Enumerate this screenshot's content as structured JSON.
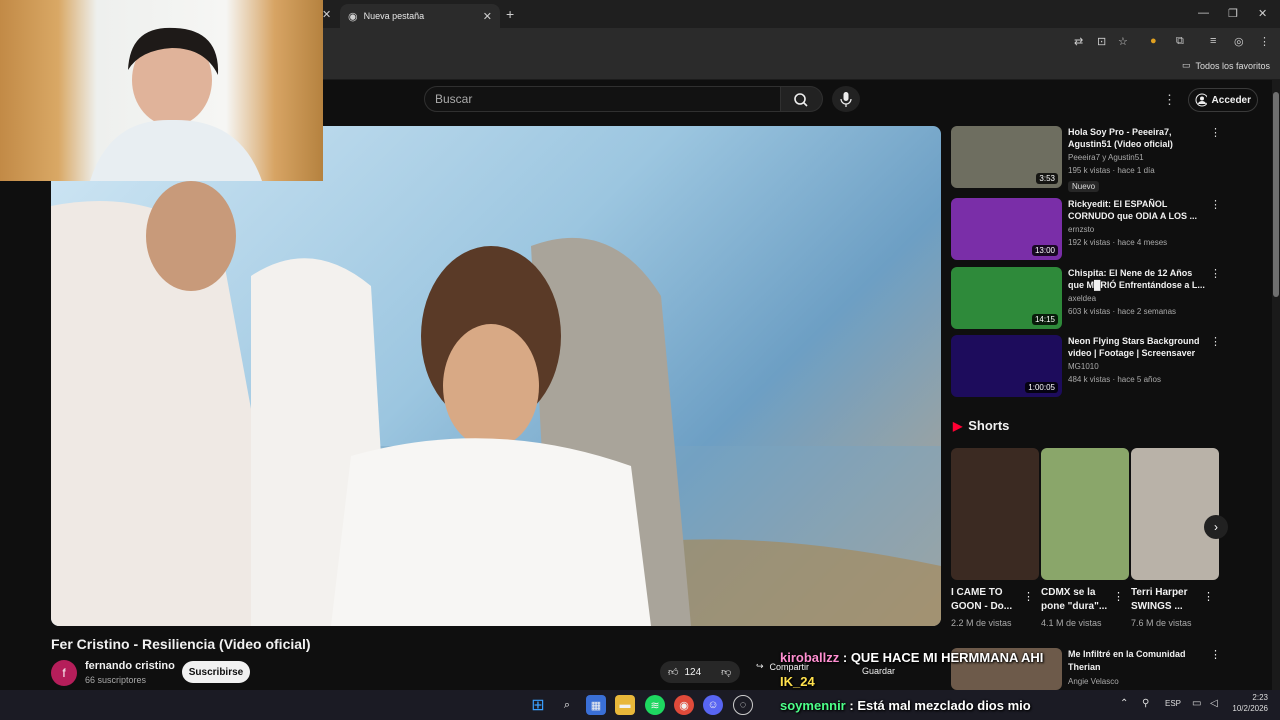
{
  "browser": {
    "tab_title": "Nueva pestaña",
    "bookmarks_label": "Todos los favoritos"
  },
  "search": {
    "placeholder": "Buscar"
  },
  "header": {
    "signin": "Acceder"
  },
  "video": {
    "title": "Fer Cristino - Resiliencia (Video oficial)",
    "channel": "fernando cristino",
    "channel_initial": "f",
    "subscribers": "66 suscriptores",
    "subscribe_label": "Suscribirse",
    "likes": "124",
    "share_label": "Compartir",
    "save_label": "Guardar"
  },
  "recommendations": [
    {
      "title": "Hola Soy Pro - Peeeira7, Agustin51 (Video oficial)",
      "channel": "Peeeira7 y Agustin51",
      "meta": "195 k vistas · hace 1 día",
      "duration": "3:53",
      "badge": "Nuevo",
      "thumb": "#6e6e60"
    },
    {
      "title": "Rickyedit: El ESPAÑOL CORNUDO que ODIA A LOS ...",
      "channel": "ernzsto",
      "meta": "192 k vistas · hace 4 meses",
      "duration": "13:00",
      "thumb": "#7a2ea8"
    },
    {
      "title": "Chispita: El Nene de 12 Años que M█RIÓ Enfrentándose a L...",
      "channel": "axeldea",
      "meta": "603 k vistas · hace 2 semanas",
      "duration": "14:15",
      "thumb": "#2e8a3a"
    },
    {
      "title": "Neon Flying Stars Background video | Footage | Screensaver",
      "channel": "MG1010",
      "meta": "484 k vistas · hace 5 años",
      "duration": "1:00:05",
      "thumb": "#1d0c5c"
    }
  ],
  "shorts": {
    "heading": "Shorts",
    "items": [
      {
        "title": "I CAME TO GOON - Do...",
        "views": "2.2 M de vistas",
        "thumb": "#3b2a22"
      },
      {
        "title": "CDMX se la pone \"dura\"...",
        "views": "4.1 M de vistas",
        "thumb": "#8aa66a"
      },
      {
        "title": "Terri Harper SWINGS ...",
        "views": "7.6 M de vistas",
        "thumb": "#b9b2a8"
      }
    ]
  },
  "extra_rec": {
    "title": "Me Infiltré en la Comunidad Therian",
    "channel": "Angie Velasco"
  },
  "chat": [
    {
      "user": "kiroballzz",
      "msg": "QUE HACE MI HERMMANA AHI",
      "color": "#ff8fd1"
    },
    {
      "user": "IK_24",
      "msg": "",
      "color": "#ffe14d"
    },
    {
      "user": "soymennir",
      "msg": "Está mal mezclado dios mio",
      "color": "#4dff8a"
    }
  ],
  "taskbar": {
    "lang": "ESP",
    "time": "2:23",
    "date": "10/2/2026"
  }
}
